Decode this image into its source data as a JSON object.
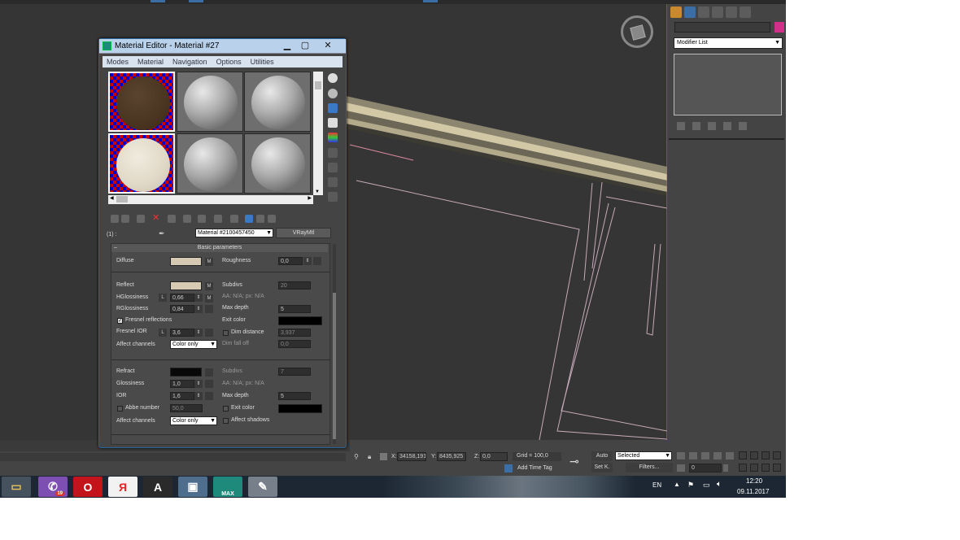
{
  "window": {
    "title": "Material Editor - Material #27",
    "minimize": "▁",
    "maximize": "▢",
    "close": "✕"
  },
  "menu": [
    "Modes",
    "Material",
    "Navigation",
    "Options",
    "Utilities"
  ],
  "material": {
    "slot_label": "(1) :",
    "name": "Material #2100457450",
    "type": "VRayMtl"
  },
  "rollout": {
    "title": "Basic parameters",
    "collapse": "–"
  },
  "diffuse": {
    "label": "Diffuse",
    "map_btn": "M",
    "roughness_label": "Roughness",
    "roughness": "0,0",
    "color": "#d5c9b4"
  },
  "reflect": {
    "label": "Reflect",
    "map_btn": "M",
    "color": "#d8cbb3",
    "hgloss_label": "HGlossiness",
    "hgloss_lock": "L",
    "hgloss": "0,66",
    "hgloss_map": "M",
    "rgloss_label": "RGlossiness",
    "rgloss": "0,84",
    "fresnel_label": "Fresnel reflections",
    "fresnel_checked": "✓",
    "fresnel_ior_label": "Fresnel IOR",
    "fresnel_ior_lock": "L",
    "fresnel_ior": "3,6",
    "affect_label": "Affect channels",
    "affect": "Color only",
    "subdivs_label": "Subdivs",
    "subdivs": "20",
    "aa": "AA: N/A; px: N/A",
    "maxdepth_label": "Max depth",
    "maxdepth": "5",
    "exit_label": "Exit color",
    "dimdist_label": "Dim distance",
    "dimdist": "3,937",
    "dimfall_label": "Dim fall off",
    "dimfall": "0,0"
  },
  "refract": {
    "label": "Refract",
    "color": "#080808",
    "gloss_label": "Glossiness",
    "gloss": "1,0",
    "ior_label": "IOR",
    "ior": "1,6",
    "abbe_label": "Abbe number",
    "abbe": "50,0",
    "affect_label": "Affect channels",
    "affect": "Color only",
    "subdivs_label": "Subdivs",
    "subdivs": "7",
    "aa": "AA: N/A; px: N/A",
    "maxdepth_label": "Max depth",
    "maxdepth": "5",
    "exit_label": "Exit color",
    "shadows_label": "Affect shadows"
  },
  "right_panel": {
    "modifier_list": "Modifier List"
  },
  "status": {
    "x_label": "X:",
    "x": "34158,191",
    "y_label": "Y:",
    "y": "8435,925",
    "z_label": "Z:",
    "z": "0,0",
    "grid": "Grid = 100,0",
    "add_time_tag": "Add Time Tag",
    "auto": "Auto",
    "setk": "Set K.",
    "selected": "Selected",
    "filters": "Filters...",
    "frame": "0"
  },
  "taskbar": {
    "lang": "EN",
    "time": "12:20",
    "date": "09.11.2017",
    "viber_badge": "19",
    "max_label": "MAX"
  },
  "colors": {
    "viewport": "#353535",
    "panel": "#444444",
    "accent": "#3399ff"
  }
}
